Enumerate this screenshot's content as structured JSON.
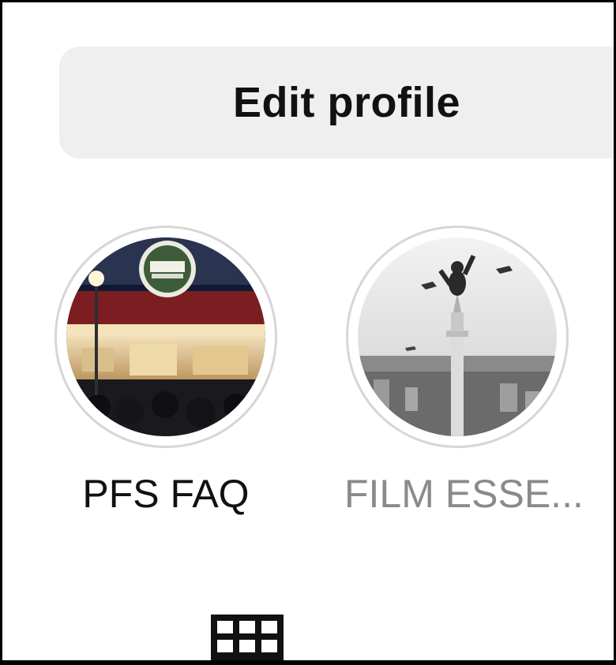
{
  "profile": {
    "edit_button_label": "Edit profile"
  },
  "highlights": [
    {
      "label": "PFS FAQ",
      "image": "film-center-marquee"
    },
    {
      "label": "FILM ESSE...",
      "image": "king-kong-empire-state"
    }
  ],
  "tabs": {
    "active_icon": "grid-icon"
  },
  "colors": {
    "button_bg": "#efefef",
    "ring": "#d6d6d6",
    "muted_text": "#8a8a8a"
  }
}
